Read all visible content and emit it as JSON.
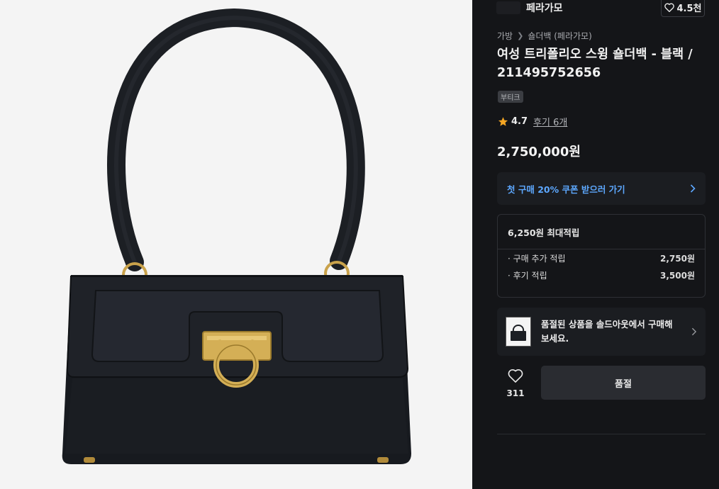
{
  "brand": {
    "name": "페라가모"
  },
  "like_top": {
    "count": "4.5천"
  },
  "breadcrumb": {
    "items": [
      "가방",
      "숄더백 (페라가모)"
    ],
    "separator": ">"
  },
  "product": {
    "title": "여성 트리폴리오 스윙 숄더백 - 블랙 / 211495752656",
    "tag": "부티크",
    "rating": "4.7",
    "review_link": "후기 6개",
    "price": "2,750,000원"
  },
  "coupon": {
    "text": "첫 구매 20% 쿠폰 받으러 가기"
  },
  "points": {
    "header": "6,250원 최대적립",
    "rows": [
      {
        "label": "· 구매 추가 적립",
        "value": "2,750원"
      },
      {
        "label": "· 후기 적립",
        "value": "3,500원"
      }
    ]
  },
  "soldout_banner": {
    "text": "품절된 상품을 솔드아웃에서 구매해 보세요."
  },
  "like_bottom": {
    "count": "311"
  },
  "action_button": {
    "label": "품절"
  },
  "colors": {
    "panel_bg": "#141518",
    "card_bg": "#1b1d21",
    "accent_blue": "#5da8ff",
    "star": "#f5a623"
  },
  "icons": {
    "heart": "heart-icon",
    "star": "star-icon",
    "chevron": "chevron-right-icon"
  }
}
